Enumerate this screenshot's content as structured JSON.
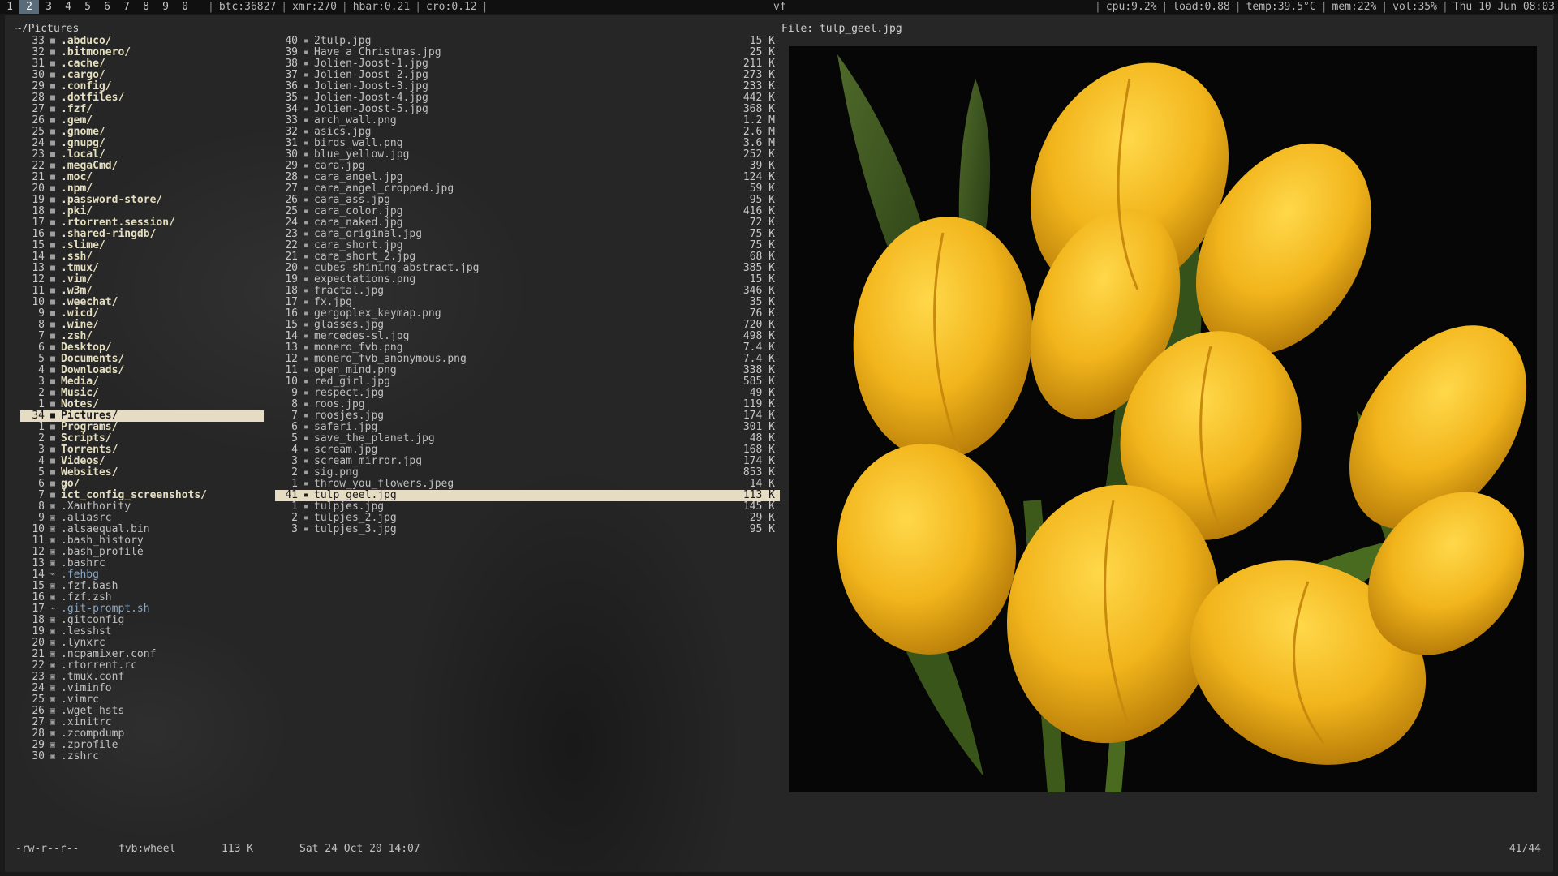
{
  "topbar": {
    "workspaces": [
      "1",
      "2",
      "3",
      "4",
      "5",
      "6",
      "7",
      "8",
      "9",
      "0"
    ],
    "active_workspace": "2",
    "left_stats": [
      "btc:36827",
      "xmr:270",
      "hbar:0.21",
      "cro:0.12"
    ],
    "center": "vf",
    "right_stats": [
      "cpu:9.2%",
      "load:0.88",
      "temp:39.5°C",
      "mem:22%",
      "vol:35%",
      "Thu 10 Jun  08:03"
    ]
  },
  "path": "~/Pictures",
  "preview_label": "File: tulp_geel.jpg",
  "parent_list": [
    {
      "n": "33",
      "t": "dir",
      "name": ".abduco/"
    },
    {
      "n": "32",
      "t": "dir",
      "name": ".bitmonero/"
    },
    {
      "n": "31",
      "t": "dir",
      "name": ".cache/"
    },
    {
      "n": "30",
      "t": "dir",
      "name": ".cargo/"
    },
    {
      "n": "29",
      "t": "dir",
      "name": ".config/"
    },
    {
      "n": "28",
      "t": "dir",
      "name": ".dotfiles/"
    },
    {
      "n": "27",
      "t": "dir",
      "name": ".fzf/"
    },
    {
      "n": "26",
      "t": "dir",
      "name": ".gem/"
    },
    {
      "n": "25",
      "t": "dir",
      "name": ".gnome/"
    },
    {
      "n": "24",
      "t": "dir",
      "name": ".gnupg/"
    },
    {
      "n": "23",
      "t": "dir",
      "name": ".local/"
    },
    {
      "n": "22",
      "t": "dir",
      "name": ".megaCmd/"
    },
    {
      "n": "21",
      "t": "dir",
      "name": ".moc/"
    },
    {
      "n": "20",
      "t": "dir",
      "name": ".npm/"
    },
    {
      "n": "19",
      "t": "dir",
      "name": ".password-store/"
    },
    {
      "n": "18",
      "t": "dir",
      "name": ".pki/"
    },
    {
      "n": "17",
      "t": "dir",
      "name": ".rtorrent.session/"
    },
    {
      "n": "16",
      "t": "dir",
      "name": ".shared-ringdb/"
    },
    {
      "n": "15",
      "t": "dir",
      "name": ".slime/"
    },
    {
      "n": "14",
      "t": "dir",
      "name": ".ssh/"
    },
    {
      "n": "13",
      "t": "dir",
      "name": ".tmux/"
    },
    {
      "n": "12",
      "t": "dir",
      "name": ".vim/"
    },
    {
      "n": "11",
      "t": "dir",
      "name": ".w3m/"
    },
    {
      "n": "10",
      "t": "dir",
      "name": ".weechat/"
    },
    {
      "n": "9",
      "t": "dir",
      "name": ".wicd/"
    },
    {
      "n": "8",
      "t": "dir",
      "name": ".wine/"
    },
    {
      "n": "7",
      "t": "dir",
      "name": ".zsh/"
    },
    {
      "n": "6",
      "t": "dir",
      "name": "Desktop/"
    },
    {
      "n": "5",
      "t": "dir",
      "name": "Documents/"
    },
    {
      "n": "4",
      "t": "dir",
      "name": "Downloads/"
    },
    {
      "n": "3",
      "t": "dir",
      "name": "Media/"
    },
    {
      "n": "2",
      "t": "dir",
      "name": "Music/"
    },
    {
      "n": "1",
      "t": "dir",
      "name": "Notes/"
    },
    {
      "n": "34",
      "t": "dir",
      "name": "Pictures/",
      "sel": true
    },
    {
      "n": "1",
      "t": "dir",
      "name": "Programs/"
    },
    {
      "n": "2",
      "t": "dir",
      "name": "Scripts/"
    },
    {
      "n": "3",
      "t": "dir",
      "name": "Torrents/"
    },
    {
      "n": "4",
      "t": "dir",
      "name": "Videos/"
    },
    {
      "n": "5",
      "t": "dir",
      "name": "Websites/"
    },
    {
      "n": "6",
      "t": "dir",
      "name": "go/"
    },
    {
      "n": "7",
      "t": "dir",
      "name": "ict_config_screenshots/"
    },
    {
      "n": "8",
      "t": "file",
      "name": ".Xauthority"
    },
    {
      "n": "9",
      "t": "file",
      "name": ".aliasrc"
    },
    {
      "n": "10",
      "t": "file",
      "name": ".alsaequal.bin"
    },
    {
      "n": "11",
      "t": "file",
      "name": ".bash_history"
    },
    {
      "n": "12",
      "t": "file",
      "name": ".bash_profile"
    },
    {
      "n": "13",
      "t": "file",
      "name": ".bashrc"
    },
    {
      "n": "14",
      "t": "link",
      "name": ".fehbg"
    },
    {
      "n": "15",
      "t": "file",
      "name": ".fzf.bash"
    },
    {
      "n": "16",
      "t": "file",
      "name": ".fzf.zsh"
    },
    {
      "n": "17",
      "t": "link",
      "name": ".git-prompt.sh"
    },
    {
      "n": "18",
      "t": "file",
      "name": ".gitconfig"
    },
    {
      "n": "19",
      "t": "file",
      "name": ".lesshst"
    },
    {
      "n": "20",
      "t": "file",
      "name": ".lynxrc"
    },
    {
      "n": "21",
      "t": "file",
      "name": ".ncpamixer.conf"
    },
    {
      "n": "22",
      "t": "file",
      "name": ".rtorrent.rc"
    },
    {
      "n": "23",
      "t": "file",
      "name": ".tmux.conf"
    },
    {
      "n": "24",
      "t": "file",
      "name": ".viminfo"
    },
    {
      "n": "25",
      "t": "file",
      "name": ".vimrc"
    },
    {
      "n": "26",
      "t": "file",
      "name": ".wget-hsts"
    },
    {
      "n": "27",
      "t": "file",
      "name": ".xinitrc"
    },
    {
      "n": "28",
      "t": "file",
      "name": ".zcompdump"
    },
    {
      "n": "29",
      "t": "file",
      "name": ".zprofile"
    },
    {
      "n": "30",
      "t": "file",
      "name": ".zshrc"
    }
  ],
  "current_list": [
    {
      "n": "40",
      "name": "2tulp.jpg",
      "size": "15 K"
    },
    {
      "n": "39",
      "name": "Have a Christmas.jpg",
      "size": "25 K"
    },
    {
      "n": "38",
      "name": "Jolien-Joost-1.jpg",
      "size": "211 K"
    },
    {
      "n": "37",
      "name": "Jolien-Joost-2.jpg",
      "size": "273 K"
    },
    {
      "n": "36",
      "name": "Jolien-Joost-3.jpg",
      "size": "233 K"
    },
    {
      "n": "35",
      "name": "Jolien-Joost-4.jpg",
      "size": "442 K"
    },
    {
      "n": "34",
      "name": "Jolien-Joost-5.jpg",
      "size": "368 K"
    },
    {
      "n": "33",
      "name": "arch_wall.png",
      "size": "1.2 M"
    },
    {
      "n": "32",
      "name": "asics.jpg",
      "size": "2.6 M"
    },
    {
      "n": "31",
      "name": "birds_wall.png",
      "size": "3.6 M"
    },
    {
      "n": "30",
      "name": "blue_yellow.jpg",
      "size": "252 K"
    },
    {
      "n": "29",
      "name": "cara.jpg",
      "size": "39 K"
    },
    {
      "n": "28",
      "name": "cara_angel.jpg",
      "size": "124 K"
    },
    {
      "n": "27",
      "name": "cara_angel_cropped.jpg",
      "size": "59 K"
    },
    {
      "n": "26",
      "name": "cara_ass.jpg",
      "size": "95 K"
    },
    {
      "n": "25",
      "name": "cara_color.jpg",
      "size": "416 K"
    },
    {
      "n": "24",
      "name": "cara_naked.jpg",
      "size": "72 K"
    },
    {
      "n": "23",
      "name": "cara_original.jpg",
      "size": "75 K"
    },
    {
      "n": "22",
      "name": "cara_short.jpg",
      "size": "75 K"
    },
    {
      "n": "21",
      "name": "cara_short_2.jpg",
      "size": "68 K"
    },
    {
      "n": "20",
      "name": "cubes-shining-abstract.jpg",
      "size": "385 K"
    },
    {
      "n": "19",
      "name": "expectations.png",
      "size": "15 K"
    },
    {
      "n": "18",
      "name": "fractal.jpg",
      "size": "346 K"
    },
    {
      "n": "17",
      "name": "fx.jpg",
      "size": "35 K"
    },
    {
      "n": "16",
      "name": "gergoplex_keymap.png",
      "size": "76 K"
    },
    {
      "n": "15",
      "name": "glasses.jpg",
      "size": "720 K"
    },
    {
      "n": "14",
      "name": "mercedes-sl.jpg",
      "size": "498 K"
    },
    {
      "n": "13",
      "name": "monero_fvb.png",
      "size": "7.4 K"
    },
    {
      "n": "12",
      "name": "monero_fvb_anonymous.png",
      "size": "7.4 K"
    },
    {
      "n": "11",
      "name": "open_mind.png",
      "size": "338 K"
    },
    {
      "n": "10",
      "name": "red_girl.jpg",
      "size": "585 K"
    },
    {
      "n": "9",
      "name": "respect.jpg",
      "size": "49 K"
    },
    {
      "n": "8",
      "name": "roos.jpg",
      "size": "119 K"
    },
    {
      "n": "7",
      "name": "roosjes.jpg",
      "size": "174 K"
    },
    {
      "n": "6",
      "name": "safari.jpg",
      "size": "301 K"
    },
    {
      "n": "5",
      "name": "save_the_planet.jpg",
      "size": "48 K"
    },
    {
      "n": "4",
      "name": "scream.jpg",
      "size": "168 K"
    },
    {
      "n": "3",
      "name": "scream_mirror.jpg",
      "size": "174 K"
    },
    {
      "n": "2",
      "name": "sig.png",
      "size": "853 K"
    },
    {
      "n": "1",
      "name": "throw_you_flowers.jpeg",
      "size": "14 K"
    },
    {
      "n": "41",
      "name": "tulp_geel.jpg",
      "size": "113 K",
      "sel": true
    },
    {
      "n": "1",
      "name": "tulpjes.jpg",
      "size": "145 K"
    },
    {
      "n": "2",
      "name": "tulpjes_2.jpg",
      "size": "29 K"
    },
    {
      "n": "3",
      "name": "tulpjes_3.jpg",
      "size": "95 K"
    }
  ],
  "status": {
    "permissions": "-rw-r--r--",
    "owner": "fvb:wheel",
    "size": "113 K",
    "mtime": "Sat 24 Oct 20 14:07",
    "position": "41/44"
  },
  "colors": {
    "selection_bg": "#e6dcc4",
    "dir_fg": "#e6dfbf",
    "link_fg": "#8aa5c0",
    "tulip_yellow": "#f2b51c"
  },
  "icons": {
    "dir": "folder-icon",
    "file": "file-icon",
    "link": "link-icon",
    "image": "image-icon"
  }
}
